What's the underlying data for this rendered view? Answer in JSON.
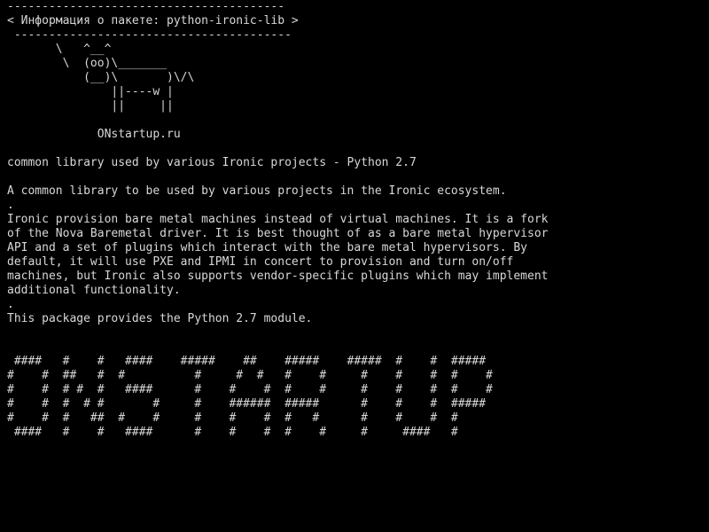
{
  "header": {
    "rule_top": "----------------------------------------",
    "title": "< Информация о пакете: python-ironic-lib >",
    "rule_bottom": " ----------------------------------------"
  },
  "cow": [
    "       \\   ^__^",
    "        \\  (oo)\\_______",
    "           (__)\\       )\\/\\",
    "               ||----w |",
    "               ||     ||"
  ],
  "site": "             ONstartup.ru",
  "summary": "common library used by various Ironic projects - Python 2.7",
  "description": [
    "A common library to be used by various projects in the Ironic ecosystem.",
    ".",
    "Ironic provision bare metal machines instead of virtual machines. It is a fork",
    "of the Nova Baremetal driver. It is best thought of as a bare metal hypervisor",
    "API and a set of plugins which interact with the bare metal hypervisors. By",
    "default, it will use PXE and IPMI in concert to provision and turn on/off",
    "machines, but Ironic also supports vendor-specific plugins which may implement",
    "additional functionality.",
    ".",
    "This package provides the Python 2.7 module."
  ],
  "banner": [
    " ####   #    #   ####    #####    ##    #####    #####  #    #  #####",
    "#    #  ##   #  #          #     #  #   #    #     #    #    #  #    #",
    "#    #  # #  #   ####      #    #    #  #    #     #    #    #  #    #",
    "#    #  #  # #       #     #    ######  #####      #    #    #  #####",
    "#    #  #   ##  #    #     #    #    #  #   #      #    #    #  #",
    " ####   #    #   ####      #    #    #  #    #     #     ####   #"
  ]
}
